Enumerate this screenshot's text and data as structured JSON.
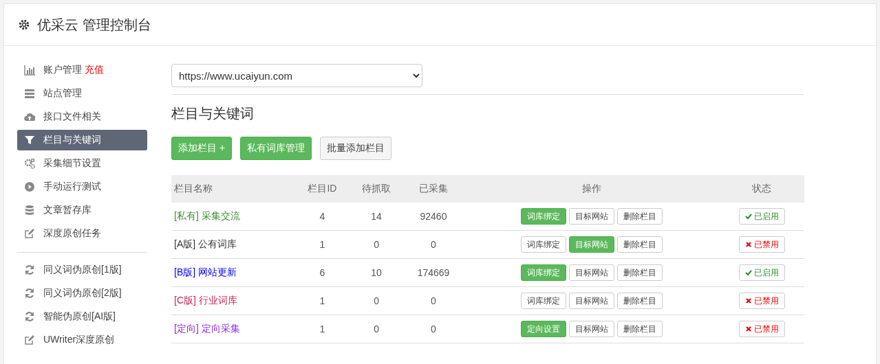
{
  "header": {
    "title": "优采云 管理控制台"
  },
  "sidebar": {
    "items": [
      {
        "label": "账户管理",
        "badge": "充值",
        "selected": false
      },
      {
        "label": "站点管理",
        "selected": false
      },
      {
        "label": "接口文件相关",
        "selected": false
      },
      {
        "label": "栏目与关键词",
        "selected": true
      },
      {
        "label": "采集细节设置",
        "selected": false
      },
      {
        "label": "手动运行测试",
        "selected": false
      },
      {
        "label": "文章暂存库",
        "selected": false
      },
      {
        "label": "深度原创任务",
        "selected": false
      },
      {
        "label": "同义词伪原创[1版]",
        "selected": false
      },
      {
        "label": "同义词伪原创[2版]",
        "selected": false
      },
      {
        "label": "智能伪原创[AI版]",
        "selected": false
      },
      {
        "label": "UWriter深度原创",
        "selected": false
      }
    ]
  },
  "site_select": {
    "value": "https://www.ucaiyun.com"
  },
  "section_title": "栏目与关键词",
  "toolbar": [
    {
      "label": "添加栏目 +",
      "primary": true
    },
    {
      "label": "私有词库管理",
      "primary": true
    },
    {
      "label": "批量添加栏目",
      "primary": false
    }
  ],
  "table": {
    "columns": [
      "栏目名称",
      "栏目ID",
      "待抓取",
      "已采集",
      "操作",
      "状态"
    ],
    "rows": [
      {
        "tag": "[私有]",
        "name": "采集交流",
        "color": "#3c8d2f",
        "id": "4",
        "pending": "14",
        "collected": "92460",
        "actions": [
          {
            "label": "词库绑定",
            "primary": true
          },
          {
            "label": "目标网站",
            "primary": false
          },
          {
            "label": "删除栏目",
            "primary": false
          }
        ],
        "status": "已启用",
        "enabled": true
      },
      {
        "tag": "[A版]",
        "name": "公有词库",
        "color": "#333333",
        "id": "1",
        "pending": "0",
        "collected": "0",
        "actions": [
          {
            "label": "词库绑定",
            "primary": false
          },
          {
            "label": "目标网站",
            "primary": true
          },
          {
            "label": "删除栏目",
            "primary": false
          }
        ],
        "status": "已禁用",
        "enabled": false
      },
      {
        "tag": "[B版]",
        "name": "网站更新",
        "color": "#0000ff",
        "id": "6",
        "pending": "10",
        "collected": "174669",
        "actions": [
          {
            "label": "词库绑定",
            "primary": true
          },
          {
            "label": "目标网站",
            "primary": false
          },
          {
            "label": "删除栏目",
            "primary": false
          }
        ],
        "status": "已启用",
        "enabled": true
      },
      {
        "tag": "[C版]",
        "name": "行业词库",
        "color": "#c7254e",
        "id": "1",
        "pending": "0",
        "collected": "0",
        "actions": [
          {
            "label": "词库绑定",
            "primary": false
          },
          {
            "label": "目标网站",
            "primary": false
          },
          {
            "label": "删除栏目",
            "primary": false
          }
        ],
        "status": "已禁用",
        "enabled": false
      },
      {
        "tag": "[定向]",
        "name": "定向采集",
        "color": "#8a2be2",
        "id": "1",
        "pending": "0",
        "collected": "0",
        "actions": [
          {
            "label": "定向设置",
            "primary": true
          },
          {
            "label": "目标网站",
            "primary": false
          },
          {
            "label": "删除栏目",
            "primary": false
          }
        ],
        "status": "已禁用",
        "enabled": false
      }
    ]
  }
}
